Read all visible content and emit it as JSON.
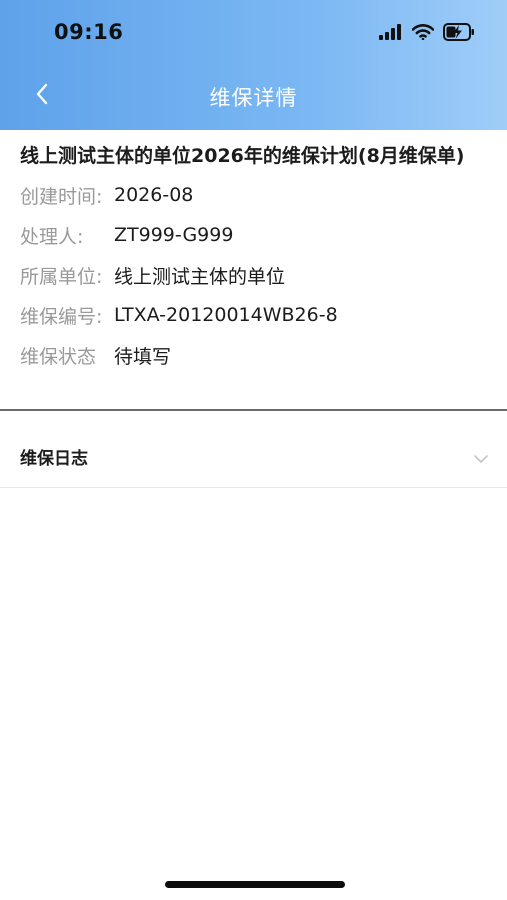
{
  "status_bar": {
    "time": "09:16",
    "icons": [
      "signal-icon",
      "wifi-icon",
      "battery-charging-icon"
    ]
  },
  "nav": {
    "title": "维保详情",
    "back_icon": "chevron-left-icon"
  },
  "plan": {
    "title": "线上测试主体的单位2026年的维保计划(8月维保单)"
  },
  "info": [
    {
      "label": "创建时间:",
      "value": "2026-08"
    },
    {
      "label": "处理人:",
      "value": "ZT999-G999"
    },
    {
      "label": "所属单位:",
      "value": "线上测试主体的单位"
    },
    {
      "label": "维保编号:",
      "value": "LTXA-20120014WB26-8"
    },
    {
      "label": "维保状态",
      "value": "待填写"
    }
  ],
  "log_section": {
    "label": "维保日志",
    "icon": "chevron-down-icon"
  },
  "colors": {
    "header_gradient_start": "#5fa2ea",
    "header_gradient_end": "#9fcdf8",
    "label_gray": "#9a9a9a",
    "text_dark": "#1c1c1c"
  }
}
